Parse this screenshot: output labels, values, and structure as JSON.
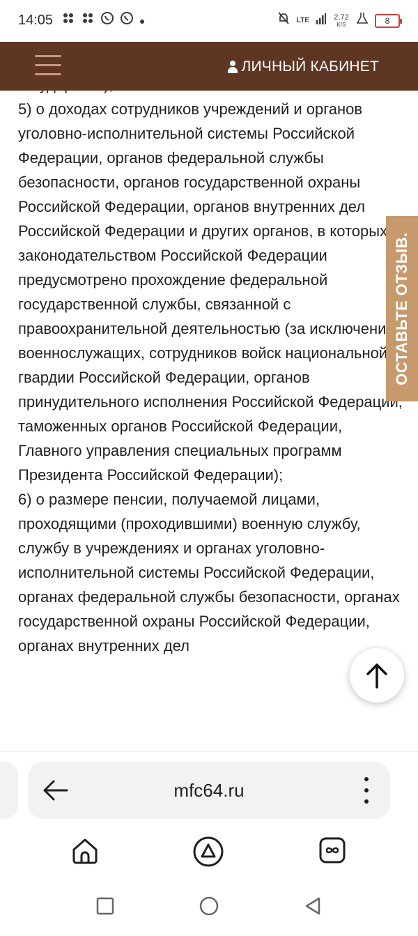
{
  "status_bar": {
    "time": "14:05",
    "network": "LTE",
    "net_speed_value": "2,72",
    "net_speed_unit": "K/S",
    "battery": "8"
  },
  "header": {
    "account_label": "ЛИЧНЫЙ КАБИНЕТ"
  },
  "content": {
    "top_cut": "государства);",
    "paragraphs": [
      "5) о доходах сотрудников учреждений и органов уголовно-исполнительной системы Российской Федерации, органов федеральной службы безопасности, органов государственной охраны Российской Федерации, органов внутренних дел Российской Федерации и других органов, в которых законодательством Российской Федерации предусмотрено прохождение федеральной государственной службы, связанной с правоохранительной деятельностью (за исключением военнослужащих, сотрудников войск национальной гвардии Российской Федерации, органов принудительного исполнения Российской Федерации, таможенных органов Российской Федерации, Главного управления специальных программ Президента Российской Федерации);",
      "6) о размере пенсии, получаемой лицами, проходящими (проходившими) военную службу, службу в учреждениях и органах уголовно-исполнительной системы Российской Федерации, органах федеральной службы безопасности, органах государственной охраны Российской Федерации, органах внутренних дел"
    ]
  },
  "feedback_tab": {
    "label": "ОСТАВЬТЕ ОТЗЫВ."
  },
  "browser": {
    "url": "mfc64.ru"
  },
  "colors": {
    "header_bg": "#5e3623",
    "hamburger": "#c69a80",
    "feedback_bg": "#c69a6d",
    "battery_low": "#d43c3c"
  },
  "icons": {
    "hamburger": "menu-icon",
    "account": "person-icon",
    "scroll_top": "arrow-up-icon",
    "back": "arrow-left-icon",
    "menu": "more-vertical-icon",
    "home": "home-icon",
    "alice": "alice-assistant-icon",
    "tabs": "tabs-icon",
    "recents": "square-icon",
    "system_home": "circle-icon",
    "system_back": "triangle-back-icon"
  }
}
